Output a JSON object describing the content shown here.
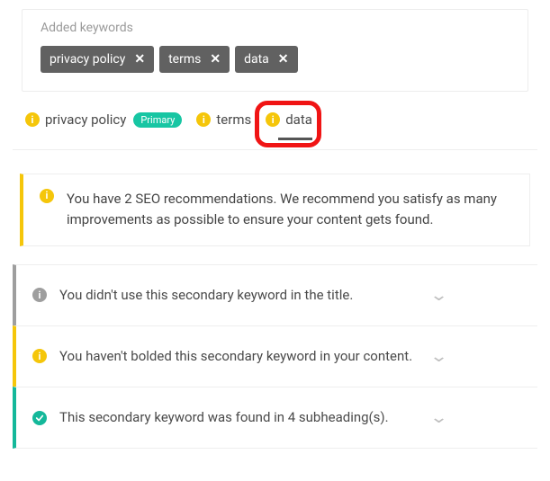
{
  "added": {
    "title": "Added keywords",
    "chips": [
      {
        "label": "privacy policy"
      },
      {
        "label": "terms"
      },
      {
        "label": "data"
      }
    ]
  },
  "tabs": [
    {
      "label": "privacy policy",
      "primary_badge": "Primary",
      "active": false,
      "highlighted": false
    },
    {
      "label": "terms",
      "primary_badge": null,
      "active": false,
      "highlighted": false
    },
    {
      "label": "data",
      "primary_badge": null,
      "active": true,
      "highlighted": true
    }
  ],
  "recommendation": {
    "text": "You have 2 SEO recommendations. We recommend you satisfy as many improvements as possible to ensure your content gets found."
  },
  "items": [
    {
      "status": "gray",
      "text": "You didn't use this secondary keyword in the title."
    },
    {
      "status": "yellow",
      "text": "You haven't bolded this secondary keyword in your content."
    },
    {
      "status": "green",
      "text": "This secondary keyword was found in 4 subheading(s)."
    }
  ]
}
